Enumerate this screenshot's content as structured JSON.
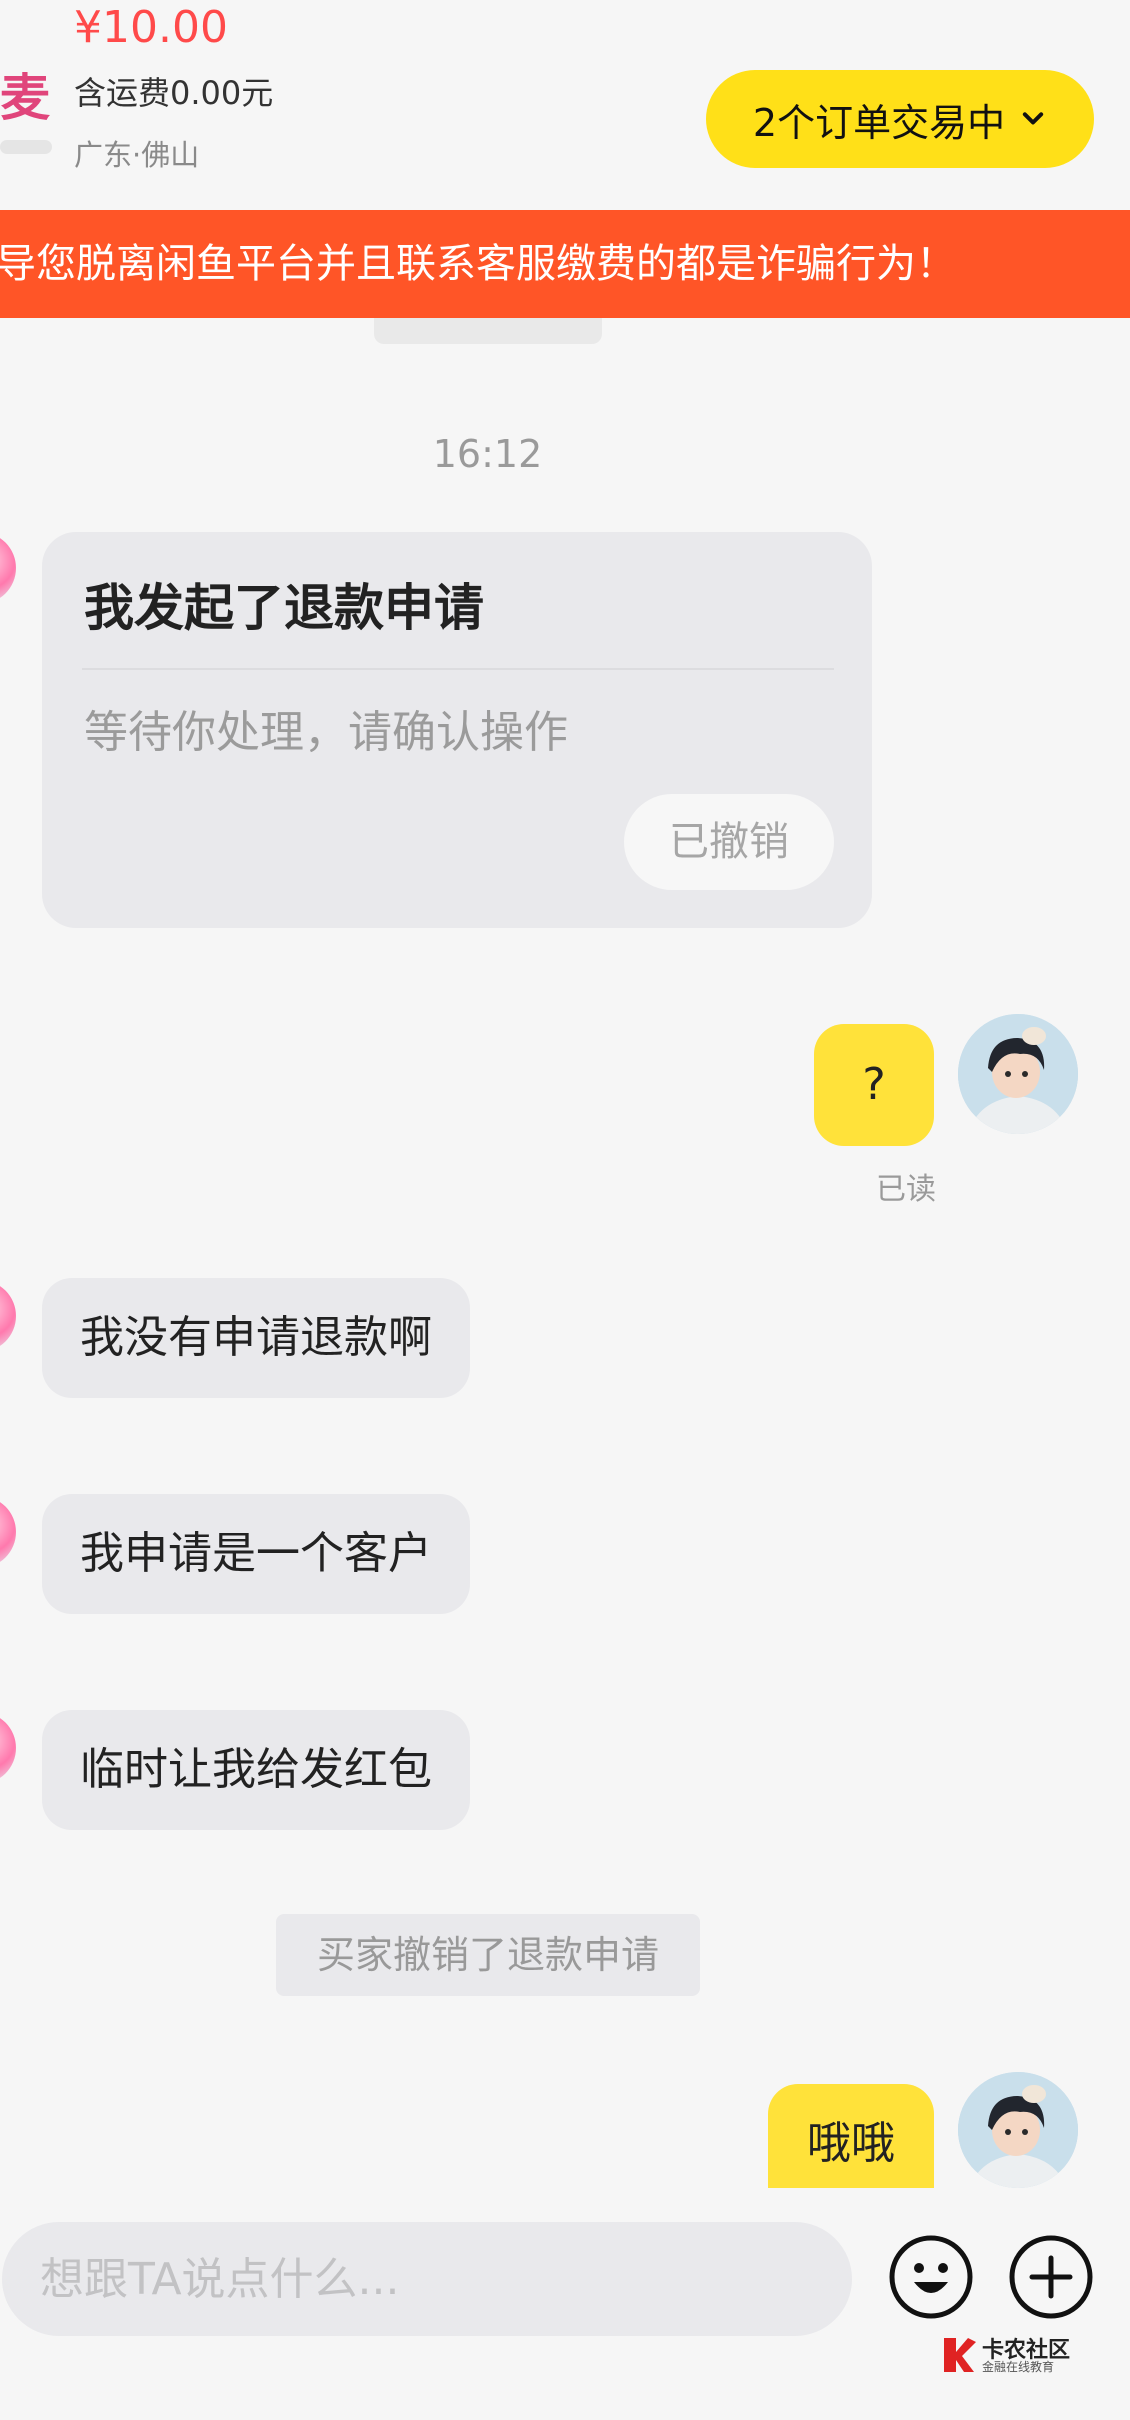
{
  "header": {
    "price": "¥10.00",
    "shipping": "含运费0.00元",
    "location": "广东·佛山",
    "product_thumb_text": "麦",
    "order_button_label": "2个订单交易中"
  },
  "warning_banner": {
    "text": "导您脱离闲鱼平台并且联系客服缴费的都是诈骗行为！"
  },
  "messages": {
    "time": "16:12",
    "refund_card": {
      "title": "我发起了退款申请",
      "description": "等待你处理，请确认操作",
      "status_label": "已撤销"
    },
    "my_question": "?",
    "read_status": "已读",
    "seller_msg_1": "我没有申请退款啊",
    "seller_msg_2": "我申请是一个客户",
    "seller_msg_3": "临时让我给发红包",
    "system_notice": "买家撤销了退款申请",
    "my_reply": "哦哦"
  },
  "input_bar": {
    "placeholder": "想跟TA说点什么..."
  },
  "watermark": {
    "name": "卡农社区",
    "sub": "金融在线教育"
  },
  "colors": {
    "accent_yellow": "#ffe018",
    "warning_orange": "#ff5527",
    "price_red": "#ff4a4a"
  }
}
